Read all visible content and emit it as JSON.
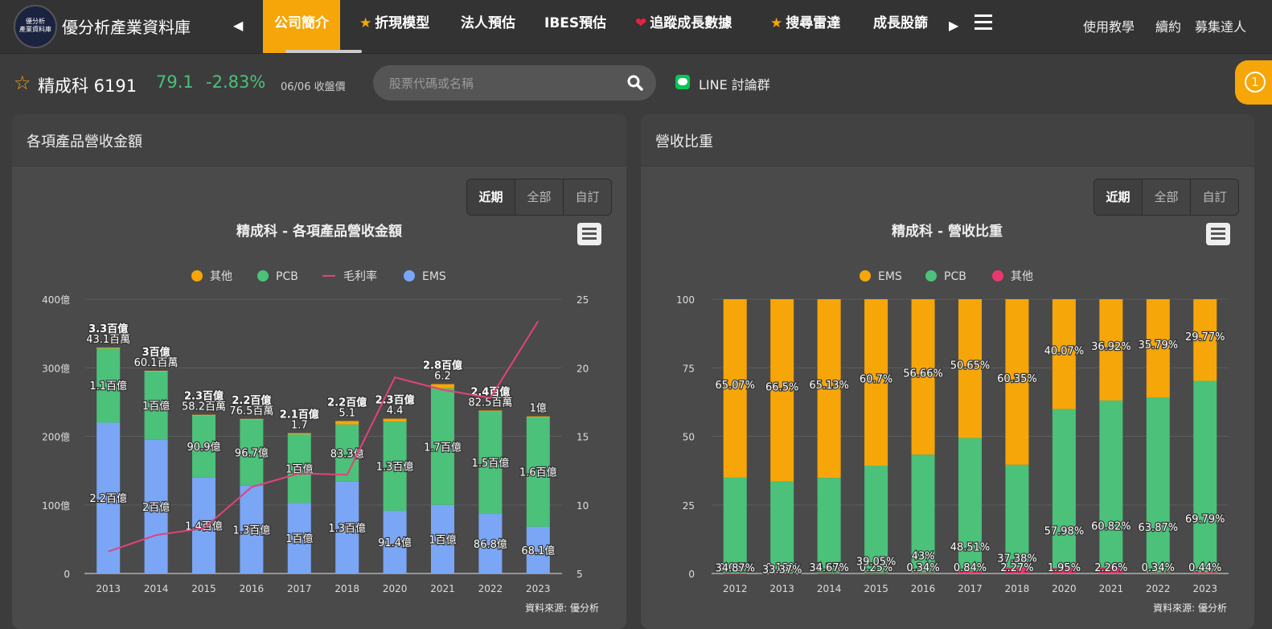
{
  "nav": {
    "brand": "優分析產業資料庫",
    "logo_text": [
      "優分析",
      "產業資料庫"
    ],
    "items": [
      {
        "label": "公司簡介",
        "icon": "",
        "active": true
      },
      {
        "label": "折現模型",
        "icon": "star"
      },
      {
        "label": "法人預估",
        "icon": ""
      },
      {
        "label": "IBES預估",
        "icon": ""
      },
      {
        "label": "追蹤成長數據",
        "icon": "heart"
      },
      {
        "label": "搜尋雷達",
        "icon": "star"
      },
      {
        "label": "成長股篩",
        "icon": ""
      }
    ],
    "right_links": [
      "使用教學",
      "續約",
      "募集達人"
    ]
  },
  "stock": {
    "name": "精成科 6191",
    "price": "79.1",
    "change": "-2.83%",
    "date": "06/06 收盤價"
  },
  "search": {
    "placeholder": "股票代碼或名稱"
  },
  "line_text": "LINE 討論群",
  "notification": "1",
  "colors": {
    "other": "#f6a609",
    "pcb": "#4bc17a",
    "ems": "#7aa6f5",
    "margin": "#e0437a",
    "other2": "#e8386f"
  },
  "left_panel": {
    "title": "各項產品營收金額",
    "segments": [
      "近期",
      "全部",
      "自訂"
    ],
    "credit": "資料來源: 優分析"
  },
  "right_panel": {
    "title": "營收比重",
    "segments": [
      "近期",
      "全部",
      "自訂"
    ],
    "credit": "資料來源: 優分析"
  },
  "chart_data": [
    {
      "type": "bar",
      "title": "精成科 - 各項產品營收金額",
      "legend": [
        "其他",
        "PCB",
        "毛利率",
        "EMS"
      ],
      "categories": [
        "2013",
        "2014",
        "2015",
        "2016",
        "2017",
        "2018",
        "2020",
        "2021",
        "2022",
        "2023"
      ],
      "y_ticks": [
        "0",
        "100億",
        "200億",
        "300億",
        "400億"
      ],
      "y2_ticks": [
        "5",
        "10",
        "15",
        "20",
        "25"
      ],
      "ylim": [
        0,
        400
      ],
      "y2lim": [
        5,
        25
      ],
      "series": [
        {
          "name": "EMS",
          "values": [
            220,
            195,
            140,
            128,
            103,
            134,
            91.4,
            100,
            86.8,
            68.1
          ],
          "labels": [
            "2.2百億",
            "2百億",
            "1.4百億",
            "1.3百億",
            "1百億",
            "1.3百億",
            "91.4億",
            "1百億",
            "86.8億",
            "68.1億"
          ]
        },
        {
          "name": "PCB",
          "values": [
            109,
            100,
            90.9,
            96.7,
            100,
            83.3,
            130,
            170,
            150,
            160
          ],
          "labels": [
            "1.1百億",
            "1百億",
            "90.9億",
            "96.7億",
            "1百億",
            "83.3億",
            "1.3百億",
            "1.7百億",
            "1.5百億",
            "1.6百億"
          ]
        },
        {
          "name": "其他",
          "values": [
            0.431,
            0.601,
            0.582,
            0.765,
            1.7,
            5.1,
            4.4,
            6.2,
            0.825,
            1
          ],
          "labels": [
            "43.1百萬",
            "60.1百萬",
            "58.2百萬",
            "76.5百萬",
            "1.7",
            "5.1",
            "4.4",
            "6.2",
            "82.5百萬",
            "1億"
          ]
        },
        {
          "name": "毛利率",
          "values": [
            6.6,
            7.8,
            8.3,
            11.3,
            12.3,
            12.2,
            19.3,
            18.4,
            17.8,
            23.4
          ]
        }
      ],
      "totals": [
        "3.3百億",
        "3百億",
        "2.3百億",
        "2.2百億",
        "2.1百億",
        "2.2百億",
        "2.3百億",
        "2.8百億",
        "2.4百億",
        ""
      ]
    },
    {
      "type": "bar",
      "title": "精成科 - 營收比重",
      "legend": [
        "EMS",
        "PCB",
        "其他"
      ],
      "categories": [
        "2012",
        "2013",
        "2014",
        "2015",
        "2016",
        "2017",
        "2018",
        "2020",
        "2021",
        "2022",
        "2023"
      ],
      "y_ticks": [
        "0",
        "25",
        "50",
        "75",
        "100"
      ],
      "ylim": [
        0,
        100
      ],
      "series": [
        {
          "name": "其他",
          "values": [
            0.06,
            0.13,
            0.2,
            0.25,
            0.34,
            0.84,
            2.27,
            1.95,
            2.26,
            0.34,
            0.44
          ],
          "labels": [
            "0.06%",
            "0.13%",
            "0.2%",
            "0.25%",
            "0.34%",
            "0.84%",
            "2.27%",
            "1.95%",
            "2.26%",
            "0.34%",
            "0.44%"
          ]
        },
        {
          "name": "PCB",
          "values": [
            34.87,
            33.37,
            34.67,
            39.05,
            43,
            48.51,
            37.38,
            57.98,
            60.82,
            63.87,
            69.79
          ],
          "labels": [
            "34.87%",
            "33.37%",
            "34.67%",
            "39.05%",
            "43%",
            "48.51%",
            "37.38%",
            "57.98%",
            "60.82%",
            "63.87%",
            "69.79%"
          ]
        },
        {
          "name": "EMS",
          "values": [
            65.07,
            66.5,
            65.13,
            60.7,
            56.66,
            50.65,
            60.35,
            40.07,
            36.92,
            35.79,
            29.77
          ],
          "labels": [
            "65.07%",
            "66.5%",
            "65.13%",
            "60.7%",
            "56.66%",
            "50.65%",
            "60.35%",
            "40.07%",
            "36.92%",
            "35.79%",
            "29.77%"
          ]
        }
      ]
    }
  ]
}
